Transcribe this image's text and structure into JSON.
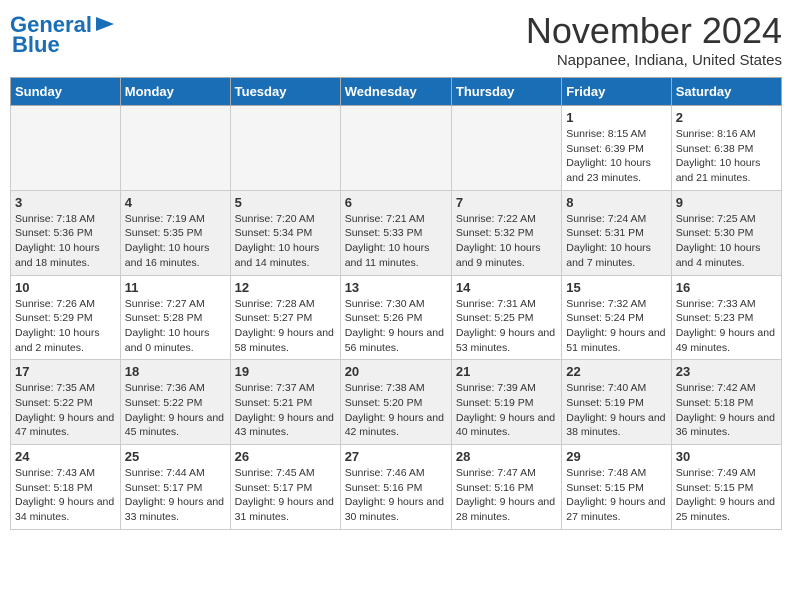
{
  "logo": {
    "general": "General",
    "blue": "Blue"
  },
  "title": "November 2024",
  "location": "Nappanee, Indiana, United States",
  "weekdays": [
    "Sunday",
    "Monday",
    "Tuesday",
    "Wednesday",
    "Thursday",
    "Friday",
    "Saturday"
  ],
  "weeks": [
    [
      {
        "day": "",
        "info": ""
      },
      {
        "day": "",
        "info": ""
      },
      {
        "day": "",
        "info": ""
      },
      {
        "day": "",
        "info": ""
      },
      {
        "day": "",
        "info": ""
      },
      {
        "day": "1",
        "info": "Sunrise: 8:15 AM\nSunset: 6:39 PM\nDaylight: 10 hours and 23 minutes."
      },
      {
        "day": "2",
        "info": "Sunrise: 8:16 AM\nSunset: 6:38 PM\nDaylight: 10 hours and 21 minutes."
      }
    ],
    [
      {
        "day": "3",
        "info": "Sunrise: 7:18 AM\nSunset: 5:36 PM\nDaylight: 10 hours and 18 minutes."
      },
      {
        "day": "4",
        "info": "Sunrise: 7:19 AM\nSunset: 5:35 PM\nDaylight: 10 hours and 16 minutes."
      },
      {
        "day": "5",
        "info": "Sunrise: 7:20 AM\nSunset: 5:34 PM\nDaylight: 10 hours and 14 minutes."
      },
      {
        "day": "6",
        "info": "Sunrise: 7:21 AM\nSunset: 5:33 PM\nDaylight: 10 hours and 11 minutes."
      },
      {
        "day": "7",
        "info": "Sunrise: 7:22 AM\nSunset: 5:32 PM\nDaylight: 10 hours and 9 minutes."
      },
      {
        "day": "8",
        "info": "Sunrise: 7:24 AM\nSunset: 5:31 PM\nDaylight: 10 hours and 7 minutes."
      },
      {
        "day": "9",
        "info": "Sunrise: 7:25 AM\nSunset: 5:30 PM\nDaylight: 10 hours and 4 minutes."
      }
    ],
    [
      {
        "day": "10",
        "info": "Sunrise: 7:26 AM\nSunset: 5:29 PM\nDaylight: 10 hours and 2 minutes."
      },
      {
        "day": "11",
        "info": "Sunrise: 7:27 AM\nSunset: 5:28 PM\nDaylight: 10 hours and 0 minutes."
      },
      {
        "day": "12",
        "info": "Sunrise: 7:28 AM\nSunset: 5:27 PM\nDaylight: 9 hours and 58 minutes."
      },
      {
        "day": "13",
        "info": "Sunrise: 7:30 AM\nSunset: 5:26 PM\nDaylight: 9 hours and 56 minutes."
      },
      {
        "day": "14",
        "info": "Sunrise: 7:31 AM\nSunset: 5:25 PM\nDaylight: 9 hours and 53 minutes."
      },
      {
        "day": "15",
        "info": "Sunrise: 7:32 AM\nSunset: 5:24 PM\nDaylight: 9 hours and 51 minutes."
      },
      {
        "day": "16",
        "info": "Sunrise: 7:33 AM\nSunset: 5:23 PM\nDaylight: 9 hours and 49 minutes."
      }
    ],
    [
      {
        "day": "17",
        "info": "Sunrise: 7:35 AM\nSunset: 5:22 PM\nDaylight: 9 hours and 47 minutes."
      },
      {
        "day": "18",
        "info": "Sunrise: 7:36 AM\nSunset: 5:22 PM\nDaylight: 9 hours and 45 minutes."
      },
      {
        "day": "19",
        "info": "Sunrise: 7:37 AM\nSunset: 5:21 PM\nDaylight: 9 hours and 43 minutes."
      },
      {
        "day": "20",
        "info": "Sunrise: 7:38 AM\nSunset: 5:20 PM\nDaylight: 9 hours and 42 minutes."
      },
      {
        "day": "21",
        "info": "Sunrise: 7:39 AM\nSunset: 5:19 PM\nDaylight: 9 hours and 40 minutes."
      },
      {
        "day": "22",
        "info": "Sunrise: 7:40 AM\nSunset: 5:19 PM\nDaylight: 9 hours and 38 minutes."
      },
      {
        "day": "23",
        "info": "Sunrise: 7:42 AM\nSunset: 5:18 PM\nDaylight: 9 hours and 36 minutes."
      }
    ],
    [
      {
        "day": "24",
        "info": "Sunrise: 7:43 AM\nSunset: 5:18 PM\nDaylight: 9 hours and 34 minutes."
      },
      {
        "day": "25",
        "info": "Sunrise: 7:44 AM\nSunset: 5:17 PM\nDaylight: 9 hours and 33 minutes."
      },
      {
        "day": "26",
        "info": "Sunrise: 7:45 AM\nSunset: 5:17 PM\nDaylight: 9 hours and 31 minutes."
      },
      {
        "day": "27",
        "info": "Sunrise: 7:46 AM\nSunset: 5:16 PM\nDaylight: 9 hours and 30 minutes."
      },
      {
        "day": "28",
        "info": "Sunrise: 7:47 AM\nSunset: 5:16 PM\nDaylight: 9 hours and 28 minutes."
      },
      {
        "day": "29",
        "info": "Sunrise: 7:48 AM\nSunset: 5:15 PM\nDaylight: 9 hours and 27 minutes."
      },
      {
        "day": "30",
        "info": "Sunrise: 7:49 AM\nSunset: 5:15 PM\nDaylight: 9 hours and 25 minutes."
      }
    ]
  ]
}
